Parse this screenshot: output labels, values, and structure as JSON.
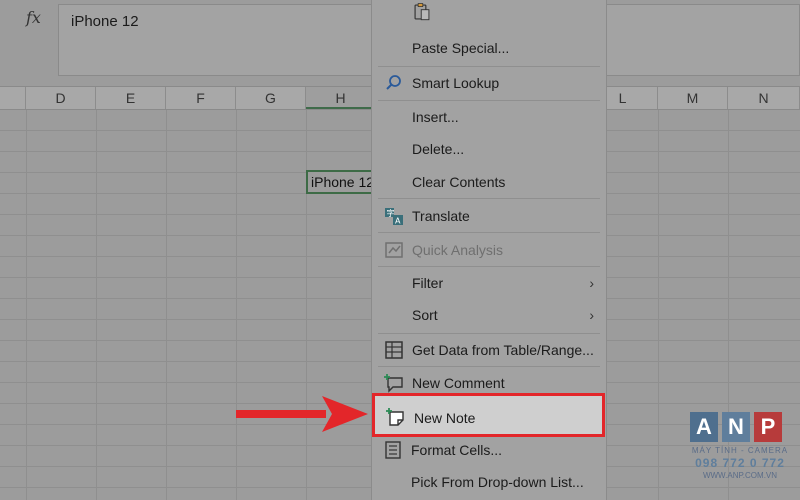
{
  "formula_bar": {
    "fx_label": "fx",
    "value": "iPhone 12"
  },
  "columns": [
    "D",
    "E",
    "F",
    "G",
    "H",
    "L",
    "M",
    "N"
  ],
  "active_cell": {
    "value": "iPhone 12"
  },
  "context_menu": {
    "items": [
      {
        "label": "Paste Special...",
        "icon": "clipboard-icon"
      },
      {
        "label": "Smart Lookup",
        "icon": "search-icon"
      },
      {
        "label": "Insert...",
        "icon": ""
      },
      {
        "label": "Delete...",
        "icon": ""
      },
      {
        "label": "Clear Contents",
        "icon": ""
      },
      {
        "label": "Translate",
        "icon": "translate-icon"
      },
      {
        "label": "Quick Analysis",
        "icon": "quick-analysis-icon",
        "disabled": true
      },
      {
        "label": "Filter",
        "icon": "",
        "submenu": true
      },
      {
        "label": "Sort",
        "icon": "",
        "submenu": true
      },
      {
        "label": "Get Data from Table/Range...",
        "icon": "table-icon"
      },
      {
        "label": "New Comment",
        "icon": "new-comment-icon"
      },
      {
        "label": "New Note",
        "icon": "new-note-icon",
        "highlighted": true
      },
      {
        "label": "Format Cells...",
        "icon": "format-cells-icon"
      },
      {
        "label": "Pick From Drop-down List...",
        "icon": ""
      }
    ]
  },
  "logo": {
    "letters": [
      "A",
      "N",
      "P"
    ],
    "tagline": "MÁY TÍNH - CAMERA",
    "phone": "098 772 0 772",
    "website": "WWW.ANP.COM.VN"
  },
  "colors": {
    "highlight_border": "#e3262a",
    "arrow": "#e3262a",
    "active_cell_border": "#3d6b46"
  }
}
